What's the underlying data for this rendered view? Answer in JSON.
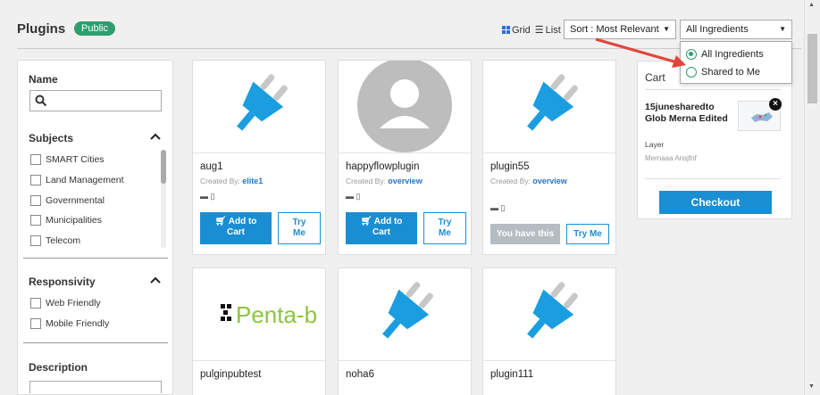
{
  "header": {
    "title": "Plugins",
    "badge": "Public",
    "grid_label": "Grid",
    "list_label": "List",
    "sort_value": "Sort : Most Relevant",
    "ingredients_value": "All Ingredients"
  },
  "ingredients_dropdown": {
    "options": [
      "All Ingredients",
      "Shared to Me"
    ],
    "selected": "All Ingredients"
  },
  "sidebar": {
    "name_heading": "Name",
    "search_placeholder": "",
    "subjects_heading": "Subjects",
    "subjects": [
      "SMART Cities",
      "Land Management",
      "Governmental",
      "Municipalities",
      "Telecom"
    ],
    "responsivity_heading": "Responsivity",
    "responsivity": [
      "Web Friendly",
      "Mobile Friendly"
    ],
    "description_heading": "Description"
  },
  "cards": [
    {
      "name": "aug1",
      "created_by_label": "Created By:",
      "creator": "elite1",
      "add_label_1": "Add to",
      "add_label_2": "Cart",
      "try_1": "Try",
      "try_2": "Me"
    },
    {
      "name": "happyflowplugin",
      "created_by_label": "Created By:",
      "creator": "overview",
      "add_label_1": "Add to",
      "add_label_2": "Cart",
      "try_1": "Try",
      "try_2": "Me"
    },
    {
      "name": "plugin55",
      "created_by_label": "Created By:",
      "creator": "overview",
      "have_label": "You have this",
      "try_label": "Try Me"
    },
    {
      "name": "pulginpubtest",
      "logo_text": "Penta-b"
    },
    {
      "name": "noha6"
    },
    {
      "name": "plugin111"
    }
  ],
  "cart": {
    "heading": "Cart",
    "item_name": "15junesharedto Glob Merna Edited",
    "item_type": "Layer",
    "item_owner": "Mernaaa Ansjfnf",
    "checkout": "Checkout"
  },
  "colors": {
    "accent": "#1a8ed2",
    "badge": "#2f9e6e",
    "arrow": "#e0453a",
    "plug": "#1a9ee0"
  }
}
